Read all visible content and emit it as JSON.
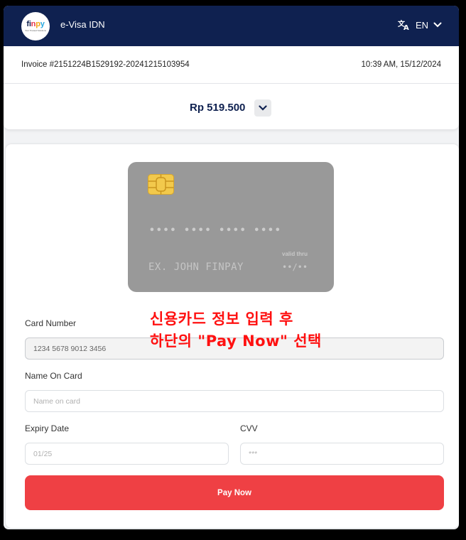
{
  "header": {
    "logo_text": "finpay",
    "logo_tagline": "Your Trusted Solutions",
    "app_title": "e-Visa IDN",
    "language": "EN",
    "language_icon": "translate-icon",
    "chevron_icon": "chevron-down-icon",
    "bg_color": "#0f2150"
  },
  "invoice": {
    "number": "Invoice #2151224B1529192-20241215103954",
    "datetime": "10:39 AM, 15/12/2024"
  },
  "amount": {
    "value": "Rp 519.500",
    "toggle_icon": "chevron-down-icon"
  },
  "card_preview": {
    "number_mask": "•••• •••• •••• ••••",
    "holder_placeholder": "EX. JOHN FINPAY",
    "valid_label": "valid thru",
    "expiry_mask": "••/••",
    "chip_icon": "card-chip-icon",
    "bg_color": "#999999"
  },
  "form": {
    "card_number": {
      "label": "Card Number",
      "placeholder": "1234 5678 9012 3456"
    },
    "name_on_card": {
      "label": "Name On Card",
      "placeholder": "Name on card"
    },
    "expiry_date": {
      "label": "Expiry Date",
      "placeholder": "01/25"
    },
    "cvv": {
      "label": "CVV",
      "placeholder": "***"
    },
    "submit_label": "Pay Now",
    "submit_color": "#ef4044"
  },
  "annotation": {
    "line1": "신용카드 정보 입력 후",
    "line2": "하단의 \"Pay Now\" 선택",
    "color": "#ff1010"
  }
}
